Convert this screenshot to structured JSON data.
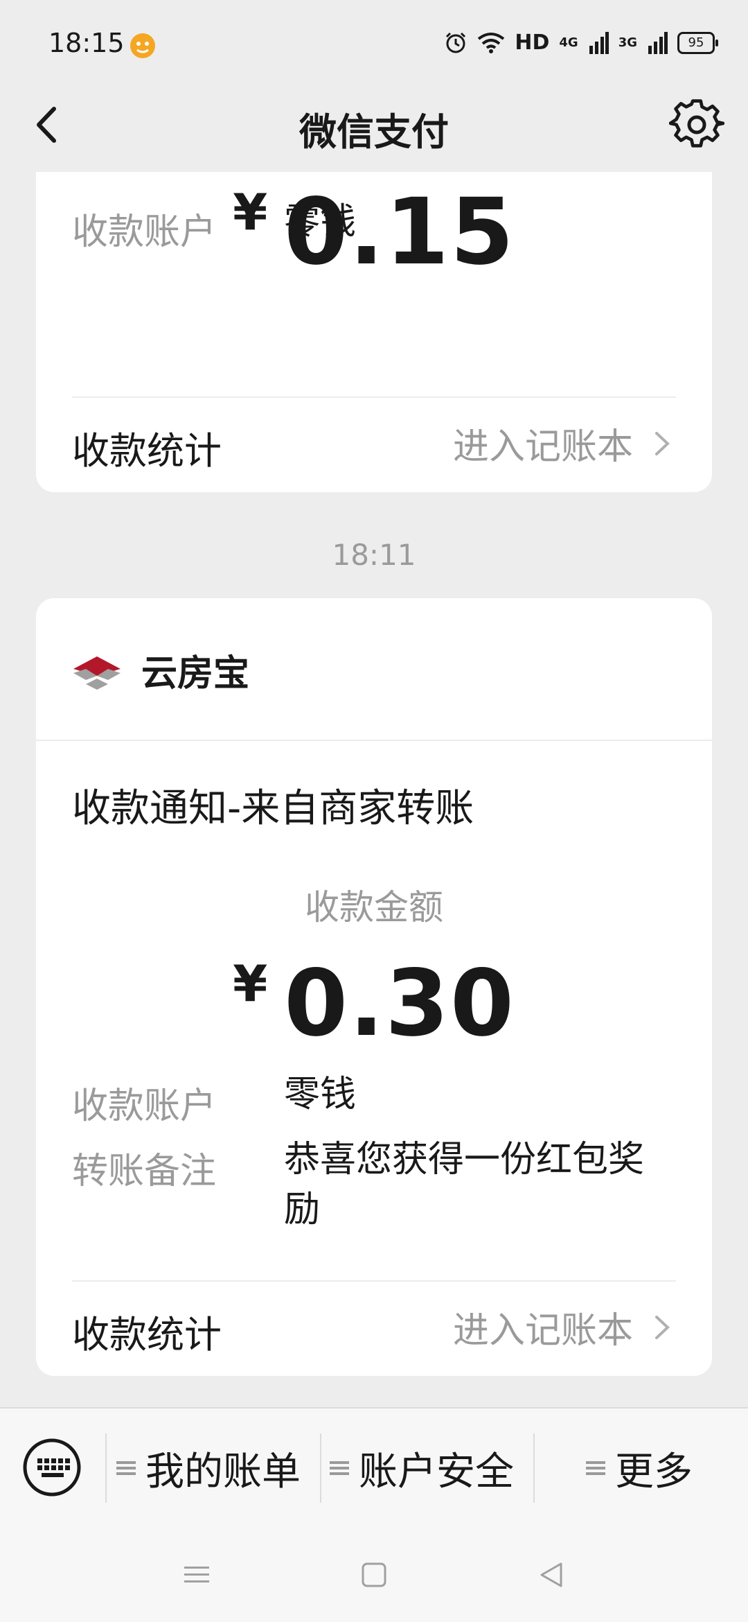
{
  "status_bar": {
    "time": "18:15",
    "network_label": "HD",
    "signal_1": "4G",
    "signal_2": "3G",
    "battery": "95"
  },
  "nav": {
    "title": "微信支付"
  },
  "card1": {
    "currency": "¥",
    "amount": "0.15",
    "account_label": "收款账户",
    "account_value": "零钱",
    "stats_label": "收款统计",
    "stats_link": "进入记账本"
  },
  "timestamp": "18:11",
  "card2": {
    "merchant": "云房宝",
    "title": "收款通知-来自商家转账",
    "amount_label": "收款金额",
    "currency": "¥",
    "amount": "0.30",
    "account_label": "收款账户",
    "account_value": "零钱",
    "remark_label": "转账备注",
    "remark_value": "恭喜您获得一份红包奖励",
    "stats_label": "收款统计",
    "stats_link": "进入记账本"
  },
  "bottom_menu": {
    "items": [
      "我的账单",
      "账户安全",
      "更多"
    ]
  },
  "colors": {
    "background": "#ededed",
    "card": "#ffffff",
    "secondary_text": "#9a9a9a",
    "merchant_logo_red": "#b3182a"
  }
}
